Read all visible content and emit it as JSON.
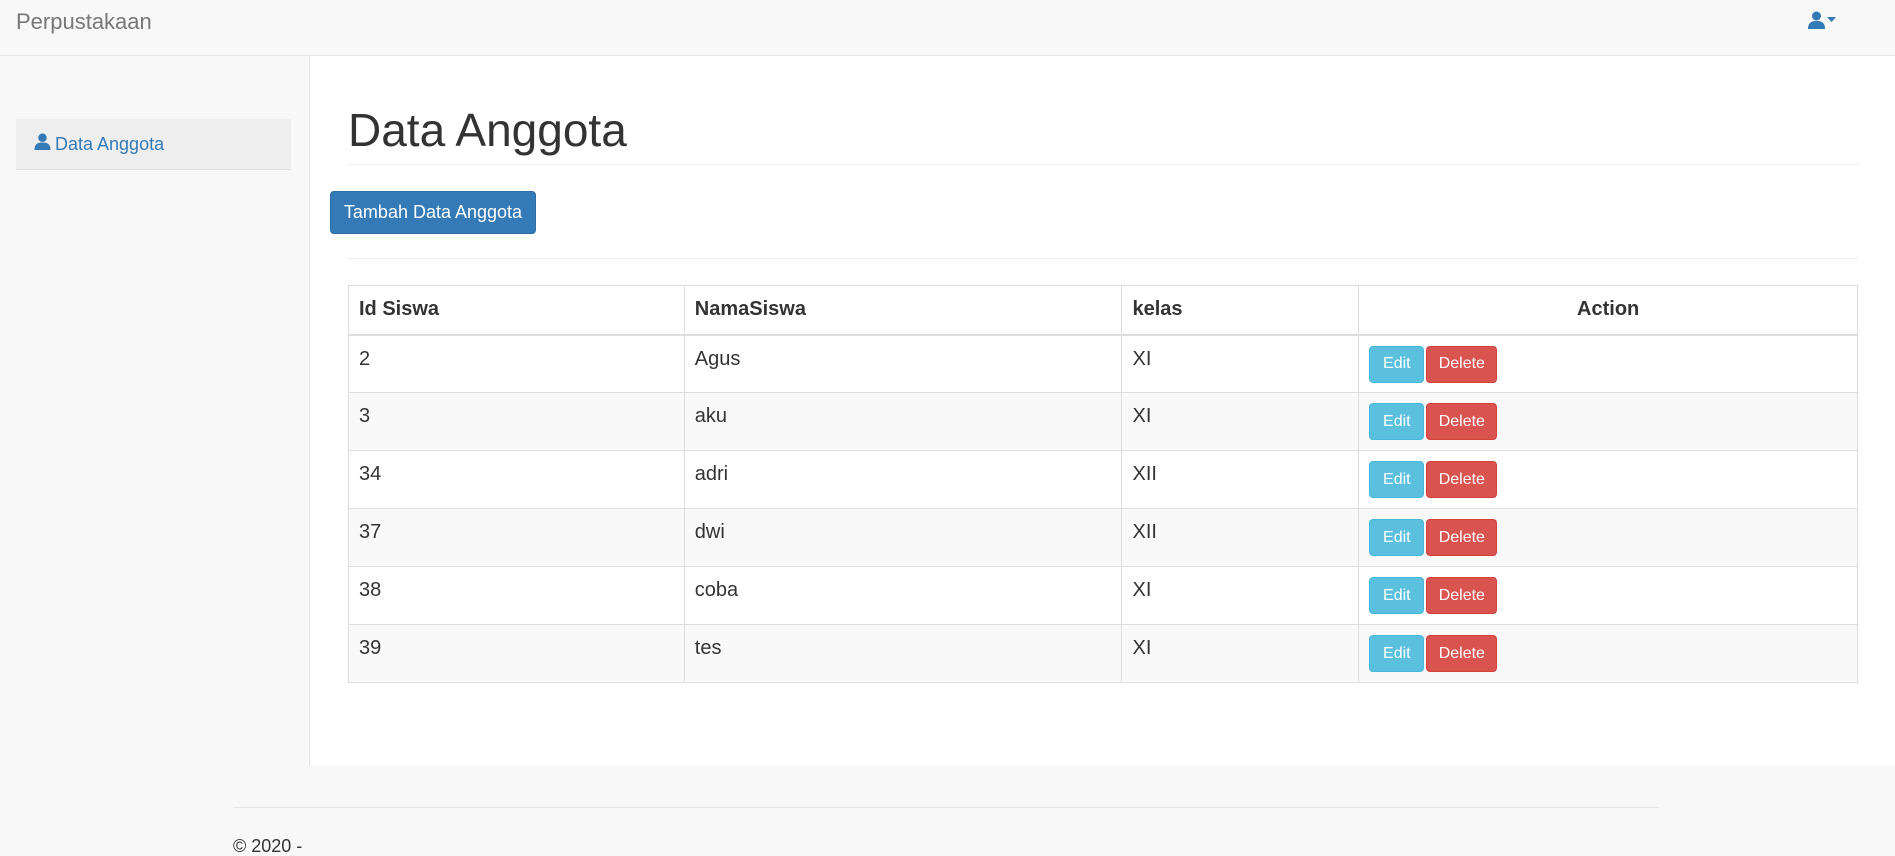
{
  "navbar": {
    "brand": "Perpustakaan",
    "user_icon": "user-icon",
    "dropdown_icon": "caret-down-icon"
  },
  "sidebar": {
    "items": [
      {
        "label": "Data Anggota",
        "icon": "user-icon"
      }
    ]
  },
  "main": {
    "title": "Data Anggota",
    "add_button": "Tambah Data Anggota"
  },
  "table": {
    "headers": [
      "Id Siswa",
      "NamaSiswa",
      "kelas",
      "Action"
    ],
    "rows": [
      {
        "id": "2",
        "nama": "Agus",
        "kelas": "XI"
      },
      {
        "id": "3",
        "nama": "aku",
        "kelas": "XI"
      },
      {
        "id": "34",
        "nama": "adri",
        "kelas": "XII"
      },
      {
        "id": "37",
        "nama": "dwi",
        "kelas": "XII"
      },
      {
        "id": "38",
        "nama": "coba",
        "kelas": "XI"
      },
      {
        "id": "39",
        "nama": "tes",
        "kelas": "XI"
      }
    ],
    "edit_label": "Edit",
    "delete_label": "Delete"
  },
  "footer": {
    "text": "© 2020 -"
  },
  "colors": {
    "primary": "#337ab7",
    "info": "#5bc0de",
    "danger": "#d9534f",
    "brand_text": "#777777"
  }
}
